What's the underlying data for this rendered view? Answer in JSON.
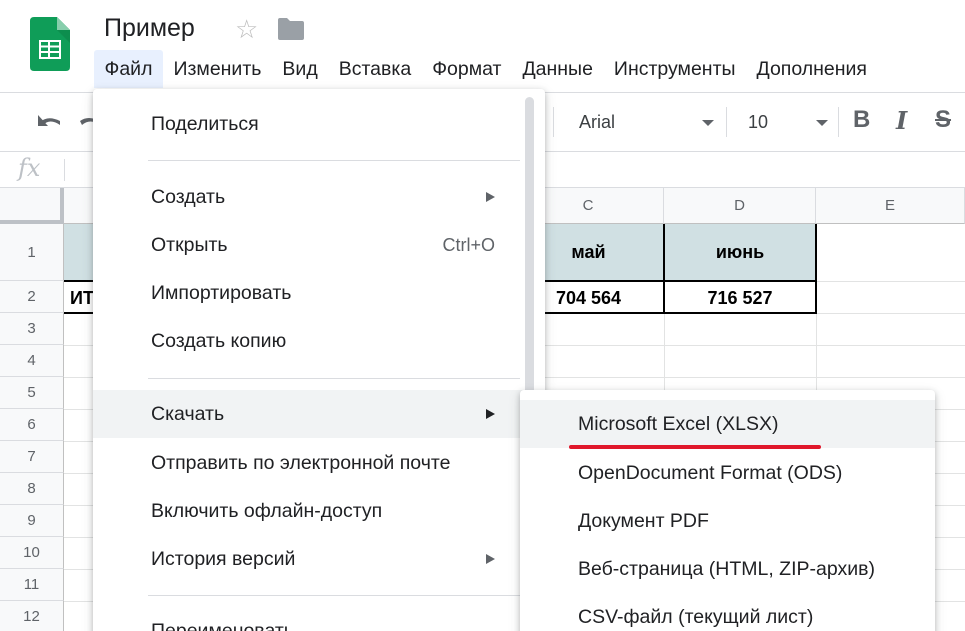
{
  "doc": {
    "title": "Пример"
  },
  "menubar": [
    {
      "label": "Файл"
    },
    {
      "label": "Изменить"
    },
    {
      "label": "Вид"
    },
    {
      "label": "Вставка"
    },
    {
      "label": "Формат"
    },
    {
      "label": "Данные"
    },
    {
      "label": "Инструменты"
    },
    {
      "label": "Дополнения"
    }
  ],
  "toolbar": {
    "font": "Arial",
    "size": "10",
    "bold": "B",
    "italic": "I",
    "strike": "S"
  },
  "formula_bar": {
    "fx": "fx"
  },
  "grid": {
    "columns": [
      "C",
      "D",
      "E"
    ],
    "rows": [
      "1",
      "2",
      "3",
      "4",
      "5",
      "6",
      "7",
      "8",
      "9",
      "10",
      "11",
      "12"
    ],
    "cells": {
      "c1": "май",
      "d1": "июнь",
      "a2": "ИТ",
      "c2": "704 564",
      "d2": "716 527"
    },
    "header_fill": "#d0e0e3"
  },
  "file_menu": {
    "share": "Поделиться",
    "create": "Создать",
    "open": "Открыть",
    "open_shortcut": "Ctrl+O",
    "import": "Импортировать",
    "copy": "Создать копию",
    "download": "Скачать",
    "email": "Отправить по электронной почте",
    "offline": "Включить офлайн-доступ",
    "history": "История версий",
    "rename": "Переименовать"
  },
  "download_submenu": {
    "xlsx": "Microsoft Excel (XLSX)",
    "ods": "OpenDocument Format (ODS)",
    "pdf": "Документ PDF",
    "html": "Веб-страница (HTML, ZIP-архив)",
    "csv": "CSV-файл (текущий лист)"
  },
  "colors": {
    "sheets_green": "#0f9d58",
    "highlight_underline": "#e0172b"
  }
}
